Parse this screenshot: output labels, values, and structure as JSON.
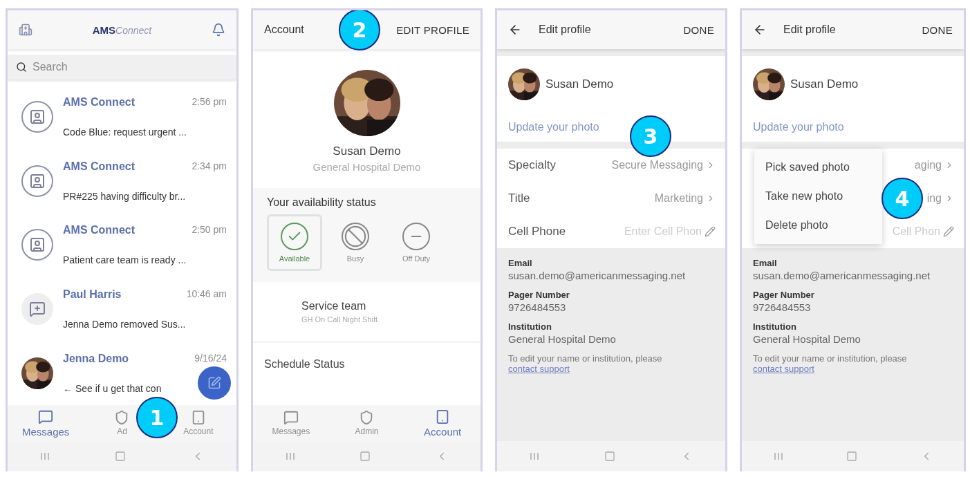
{
  "panels": [
    {
      "kind": "messages",
      "badge": "1",
      "logo": {
        "bold": "AMS",
        "script": "Connect"
      },
      "search": {
        "placeholder": "Search"
      },
      "messages": [
        {
          "sender": "AMS Connect",
          "time": "2:56 pm",
          "preview": "Code Blue: request urgent ...",
          "kind": "app"
        },
        {
          "sender": "AMS Connect",
          "time": "2:34 pm",
          "preview": "PR#225 having difficulty br...",
          "kind": "app"
        },
        {
          "sender": "AMS Connect",
          "time": "2:50 pm",
          "preview": "Patient care team is ready ...",
          "kind": "app"
        },
        {
          "sender": "Paul Harris",
          "time": "10:46 am",
          "preview": "Jenna Demo removed Sus...",
          "kind": "group"
        },
        {
          "sender": "Jenna Demo",
          "time": "9/16/24",
          "preview": "← See if u get that con",
          "kind": "picture"
        }
      ],
      "tabs": [
        {
          "label": "Messages",
          "selected": true
        },
        {
          "label": "Ad",
          "selected": false
        },
        {
          "label": "Account",
          "selected": false
        }
      ]
    },
    {
      "kind": "account",
      "badge": "2",
      "title": "Account",
      "action": "EDIT PROFILE",
      "name": "Susan Demo",
      "organization": "General Hospital Demo",
      "availability": {
        "title": "Your availability status",
        "options": [
          {
            "label": "Available",
            "selected": true,
            "kind": "check"
          },
          {
            "label": "Busy",
            "selected": false,
            "kind": "ban"
          },
          {
            "label": "Off Duty",
            "selected": false,
            "kind": "minus"
          }
        ]
      },
      "service_team": {
        "title": "Service team",
        "subtitle": "GH On Call Night Shift"
      },
      "schedule_title": "Schedule Status",
      "tabs": [
        {
          "label": "Messages",
          "selected": false
        },
        {
          "label": "Admin",
          "selected": false
        },
        {
          "label": "Account",
          "selected": true
        }
      ]
    },
    {
      "kind": "edit",
      "badge": "3",
      "title": "Edit profile",
      "action": "DONE",
      "name": "Susan Demo",
      "photo_link": "Update your photo",
      "rows": [
        {
          "label": "Specialty",
          "value": "Secure Messaging",
          "kind": "select"
        },
        {
          "label": "Title",
          "value": "Marketing",
          "kind": "select"
        },
        {
          "label": "Cell Phone",
          "placeholder": "Enter Cell Phon",
          "kind": "edit"
        }
      ],
      "info": [
        {
          "label": "Email",
          "value": "susan.demo@americanmessaging.net"
        },
        {
          "label": "Pager Number",
          "value": "9726484553"
        },
        {
          "label": "Institution",
          "value": "General Hospital Demo"
        }
      ],
      "note": "To edit your name or institution, please",
      "note_link": "contact support"
    },
    {
      "kind": "edit",
      "badge": "4",
      "title": "Edit profile",
      "action": "DONE",
      "name": "Susan Demo",
      "photo_link": "Update your photo",
      "rows": [
        {
          "value": "aging",
          "kind": "select"
        },
        {
          "value": "ing",
          "kind": "select"
        },
        {
          "placeholder": "Cell Phon",
          "kind": "edit"
        }
      ],
      "menu": [
        "Pick saved photo",
        "Take new photo",
        "Delete photo"
      ],
      "info": [
        {
          "label": "Email",
          "value": "susan.demo@americanmessaging.net"
        },
        {
          "label": "Pager Number",
          "value": "9726484553"
        },
        {
          "label": "Institution",
          "value": "General Hospital Demo"
        }
      ],
      "note": "To edit your name or institution, please",
      "note_link": "contact support"
    }
  ]
}
